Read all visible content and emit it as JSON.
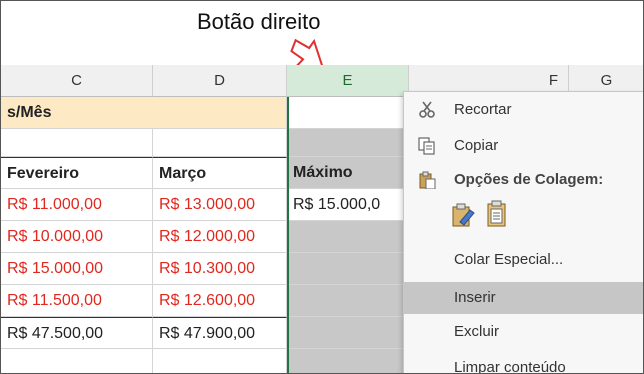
{
  "annotation": {
    "text": "Botão direito"
  },
  "columns": [
    "C",
    "D",
    "E",
    "F",
    "G"
  ],
  "sheet": {
    "title_fragment": "s/Mês",
    "headers": {
      "c": "Fevereiro",
      "d": "Março",
      "e": "Máximo"
    },
    "rows": [
      {
        "c": "R$ 11.000,00",
        "d": "R$ 13.000,00",
        "e": "R$ 15.000,0",
        "c_color": "red",
        "d_color": "red"
      },
      {
        "c": "R$ 10.000,00",
        "d": "R$ 12.000,00",
        "e": "",
        "c_color": "red",
        "d_color": "red"
      },
      {
        "c": "R$ 15.000,00",
        "d": "R$ 10.300,00",
        "e": "",
        "c_color": "red",
        "d_color": "red"
      },
      {
        "c": "R$ 11.500,00",
        "d": "R$ 12.600,00",
        "e": "",
        "c_color": "red",
        "d_color": "red"
      },
      {
        "c": "R$ 47.500,00",
        "d": "R$ 47.900,00",
        "e": "",
        "c_color": "black",
        "d_color": "black"
      }
    ]
  },
  "context_menu": {
    "items": [
      {
        "label": "Recortar",
        "icon": "scissors-icon"
      },
      {
        "label": "Copiar",
        "icon": "copy-icon"
      },
      {
        "label": "Opções de Colagem:",
        "icon": "paste-icon"
      },
      {
        "label": "Colar Especial...",
        "icon": ""
      },
      {
        "label": "Inserir",
        "icon": ""
      },
      {
        "label": "Excluir",
        "icon": ""
      },
      {
        "label": "Limpar conteúdo",
        "icon": ""
      }
    ],
    "paste_options": [
      "paste-format-icon",
      "paste-values-icon"
    ]
  },
  "colors": {
    "accent": "#217346",
    "red_text": "#e0281f",
    "header_fill": "#fde9c4",
    "selected_header": "#d6ead9",
    "gray_fill": "#c8c8c8"
  }
}
